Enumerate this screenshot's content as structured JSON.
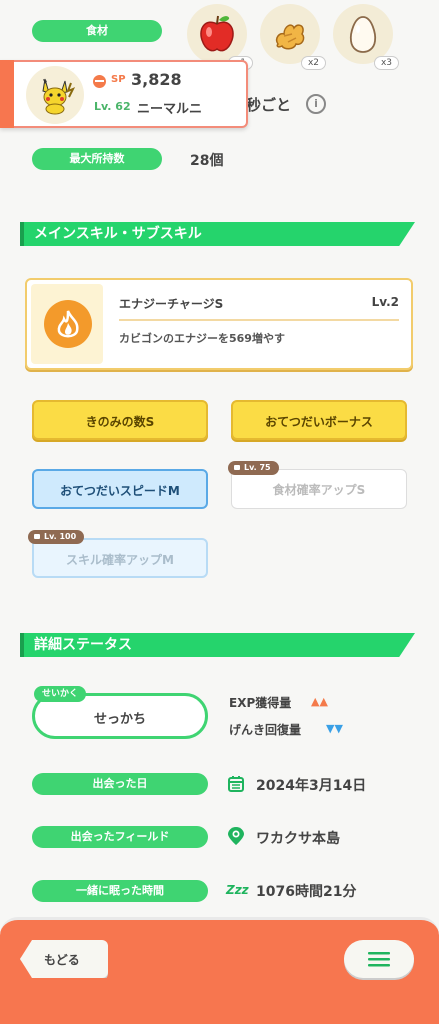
{
  "ingredients": {
    "label": "食材",
    "items": [
      {
        "icon": "apple-icon",
        "count": "x1"
      },
      {
        "icon": "ginger-icon",
        "count": "x2"
      },
      {
        "icon": "egg-icon",
        "count": "x3"
      }
    ]
  },
  "pokemon_card": {
    "sp_label": "SP",
    "sp_value": "3,828",
    "level": "Lv. 62",
    "nickname": "ニーマルニ"
  },
  "interval_text": "秒ごと",
  "info_icon": "i",
  "max_carry": {
    "label": "最大所持数",
    "value": "28個"
  },
  "skills_section": {
    "title": "メインスキル・サブスキル"
  },
  "main_skill": {
    "name": "エナジーチャージS",
    "level": "Lv.2",
    "description": "カビゴンのエナジーを569増やす"
  },
  "sub_skills": [
    {
      "label": "きのみの数S"
    },
    {
      "label": "おてつだいボーナス"
    },
    {
      "label": "おてつだいスピードM"
    },
    {
      "label": "食材確率アップS",
      "lock": "Lv. 75"
    },
    {
      "label": "スキル確率アップM",
      "lock": "Lv. 100"
    }
  ],
  "status_section": {
    "title": "詳細ステータス"
  },
  "nature": {
    "tag": "せいかく",
    "value": "せっかち",
    "up_label": "EXP獲得量",
    "up_arrows": "▲▲",
    "down_label": "げんき回復量",
    "down_arrows": "▼▼"
  },
  "details": [
    {
      "label": "出会った日",
      "icon": "calendar-icon",
      "value": "2024年3月14日"
    },
    {
      "label": "出会ったフィールド",
      "icon": "location-pin-icon",
      "value": "ワカクサ本島"
    },
    {
      "label": "一緒に眠った時間",
      "icon": "sleep-zzz-icon",
      "icon_text": "Zzz",
      "value": "1076時間21分"
    }
  ],
  "footer": {
    "back_label": "もどる",
    "menu_icon": "hamburger-menu-icon"
  },
  "colors": {
    "accent_green": "#3fd472",
    "footer_orange": "#f7764f",
    "up_arrow": "#f47a4a",
    "down_arrow": "#3aa0e6"
  }
}
